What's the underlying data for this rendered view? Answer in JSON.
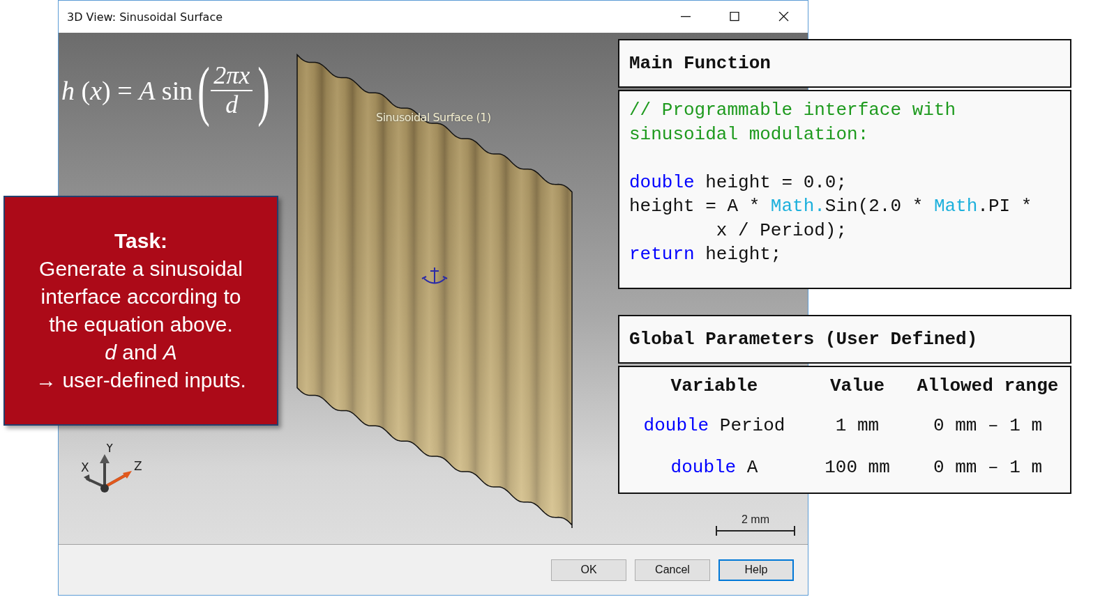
{
  "window": {
    "title": "3D View: Sinusoidal Surface"
  },
  "viewport": {
    "equation": {
      "lhs": "*h* (*x*) = *A* sin",
      "open": "(",
      "numerator": "2πx",
      "denominator": "*d*",
      "close": ")"
    },
    "surface_label": "Sinusoidal Surface (1)",
    "axes": {
      "x": "X",
      "y": "Y",
      "z": "Z"
    },
    "scale_bar": "2 mm"
  },
  "buttons": [
    {
      "label": "OK",
      "focused": false
    },
    {
      "label": "Cancel",
      "focused": false
    },
    {
      "label": "Help",
      "focused": true
    }
  ],
  "task": {
    "title": "Task:",
    "lines": [
      "Generate a sinusoidal",
      "interface according to",
      "the equation above.",
      "*d* and *A*",
      "→ user-defined inputs."
    ]
  },
  "main_function": {
    "title": "Main Function",
    "lines": [
      {
        "blank_before": false,
        "tokens": [
          {
            "kind": "comment",
            "text": "// Programmable interface with"
          }
        ]
      },
      {
        "blank_before": false,
        "tokens": [
          {
            "kind": "comment",
            "text": "sinusoidal modulation:"
          }
        ]
      },
      {
        "blank_before": true,
        "tokens": [
          {
            "kind": "keyword",
            "text": "double"
          },
          {
            "kind": "plain",
            "text": " height = 0.0;"
          }
        ]
      },
      {
        "blank_before": false,
        "tokens": [
          {
            "kind": "plain",
            "text": "height = A * "
          },
          {
            "kind": "class",
            "text": "Math."
          },
          {
            "kind": "plain",
            "text": "Sin(2.0 * "
          },
          {
            "kind": "class",
            "text": "Math"
          },
          {
            "kind": "plain",
            "text": ".PI *"
          }
        ]
      },
      {
        "blank_before": false,
        "tokens": [
          {
            "kind": "plain",
            "text": "        x / Period);"
          }
        ]
      },
      {
        "blank_before": false,
        "tokens": [
          {
            "kind": "keyword",
            "text": "return"
          },
          {
            "kind": "plain",
            "text": " height;"
          }
        ]
      }
    ]
  },
  "global_parameters": {
    "title": "Global Parameters (User Defined)",
    "columns": [
      "Variable",
      "Value",
      "Allowed range"
    ],
    "rows": [
      {
        "type": "double",
        "name": "Period",
        "value": "1 mm",
        "range": "0 mm – 1 m"
      },
      {
        "type": "double",
        "name": "A",
        "value": "100 mm",
        "range": "0 mm – 1 m"
      }
    ]
  }
}
